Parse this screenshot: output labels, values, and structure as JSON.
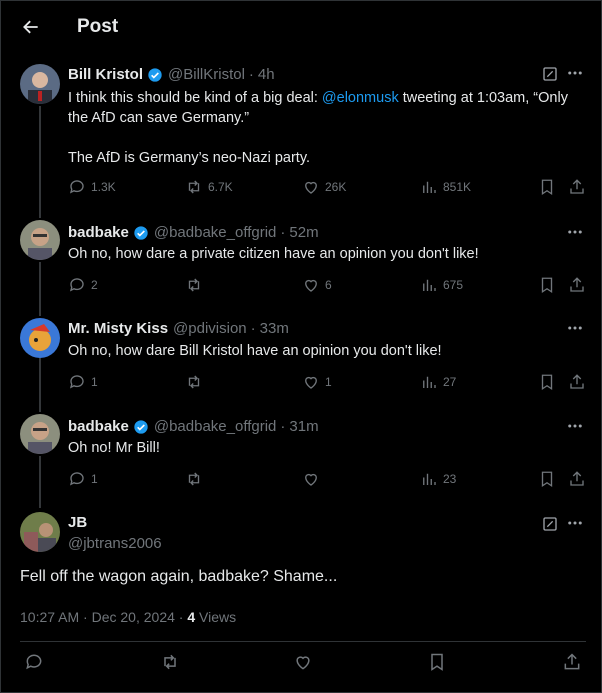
{
  "header": {
    "title": "Post"
  },
  "posts": [
    {
      "name": "Bill Kristol",
      "handle": "@BillKristol",
      "time": "4h",
      "verified": true,
      "text_before": "I think this should be kind of a big deal: ",
      "mention": "@elonmusk",
      "text_after": " tweeting at 1:03am, “Only the AfD can save Germany.”",
      "text_2": "The AfD is Germany’s neo-Nazi party.",
      "replies": "1.3K",
      "reposts": "6.7K",
      "likes": "26K",
      "views": "851K"
    },
    {
      "name": "badbake",
      "handle": "@badbake_offgrid",
      "time": "52m",
      "verified": true,
      "text": "Oh no, how dare a private citizen have an opinion you don't like!",
      "replies": "2",
      "reposts": "",
      "likes": "6",
      "views": "675"
    },
    {
      "name": "Mr. Misty Kiss",
      "handle": "@pdivision",
      "time": "33m",
      "verified": false,
      "text": "Oh no, how dare Bill Kristol have an opinion you don't like!",
      "replies": "1",
      "reposts": "",
      "likes": "1",
      "views": "27"
    },
    {
      "name": "badbake",
      "handle": "@badbake_offgrid",
      "time": "31m",
      "verified": true,
      "text": "Oh no! Mr Bill!",
      "replies": "1",
      "reposts": "",
      "likes": "",
      "views": "23"
    }
  ],
  "main_post": {
    "name": "JB",
    "handle": "@jbtrans2006",
    "text": "Fell off the wagon again, badbake? Shame...",
    "time": "10:27 AM",
    "date": "Dec 20, 2024",
    "views_count": "4",
    "views_label": "Views"
  },
  "colors": {
    "background": "#000000",
    "text": "#e7e9ea",
    "muted": "#71767b",
    "accent": "#1d9bf0"
  },
  "icons": [
    "back-arrow-icon",
    "verified-badge-icon",
    "grok-icon",
    "more-icon",
    "reply-icon",
    "repost-icon",
    "like-icon",
    "views-icon",
    "bookmark-icon",
    "share-icon"
  ]
}
